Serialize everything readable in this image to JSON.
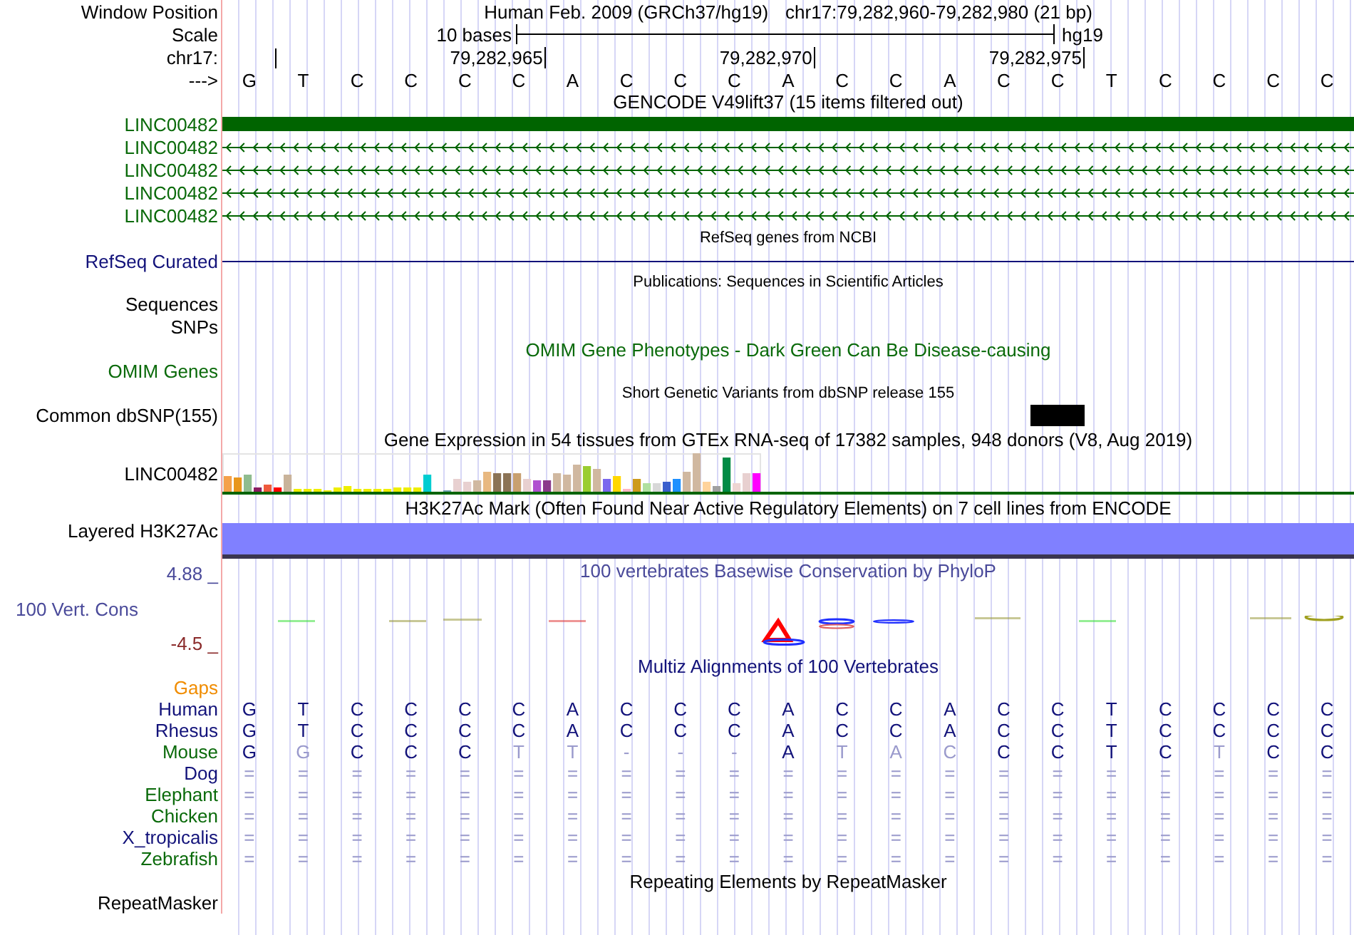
{
  "header": {
    "label": "Window Position",
    "assembly": "Human Feb. 2009 (GRCh37/hg19)",
    "position": "chr17:79,282,960-79,282,980 (21 bp)"
  },
  "scale": {
    "label": "Scale",
    "span": "10 bases",
    "assembly": "hg19"
  },
  "coordinates": {
    "label": "chr17:",
    "ticks": [
      "79,282,965",
      "79,282,970",
      "79,282,975"
    ]
  },
  "sequence": {
    "label": "--->",
    "bases": [
      "G",
      "T",
      "C",
      "C",
      "C",
      "C",
      "A",
      "C",
      "C",
      "C",
      "A",
      "C",
      "C",
      "A",
      "C",
      "C",
      "T",
      "C",
      "C",
      "C",
      "C"
    ]
  },
  "gencode": {
    "title": "GENCODE V49lift37 (15 items filtered out)",
    "genes": [
      {
        "label": "LINC00482",
        "kind": "block"
      },
      {
        "label": "LINC00482",
        "kind": "arrows"
      },
      {
        "label": "LINC00482",
        "kind": "arrows"
      },
      {
        "label": "LINC00482",
        "kind": "arrows"
      },
      {
        "label": "LINC00482",
        "kind": "arrows"
      }
    ]
  },
  "refseq": {
    "title": "RefSeq genes from NCBI",
    "label": "RefSeq Curated"
  },
  "publications": {
    "title": "Publications: Sequences in Scientific Articles",
    "labels": [
      "Sequences",
      "SNPs"
    ]
  },
  "omim": {
    "title": "OMIM Gene Phenotypes - Dark Green Can Be Disease-causing",
    "label": "OMIM Genes"
  },
  "dbsnp": {
    "title": "Short Genetic Variants from dbSNP release 155",
    "label": "Common dbSNP(155)"
  },
  "gtex": {
    "title": "Gene Expression in 54 tissues from GTEx RNA-seq of 17382 samples, 948 donors (V8, Aug 2019)",
    "label": "LINC00482"
  },
  "h3k27ac": {
    "title": "H3K27Ac Mark (Often Found Near Active Regulatory Elements) on 7 cell lines from ENCODE",
    "label": "Layered H3K27Ac"
  },
  "phylop": {
    "title": "100 vertebrates Basewise Conservation by PhyloP",
    "label": "100 Vert. Cons",
    "max": "4.88 _",
    "min": "-4.5 _"
  },
  "multiz": {
    "title": "Multiz Alignments of 100 Vertebrates",
    "gaps_label": "Gaps",
    "species": [
      {
        "name": "Human",
        "color": "#12127a",
        "bases": [
          {
            "b": "G",
            "faded": false
          },
          {
            "b": "T",
            "faded": false
          },
          {
            "b": "C",
            "faded": false
          },
          {
            "b": "C",
            "faded": false
          },
          {
            "b": "C",
            "faded": false
          },
          {
            "b": "C",
            "faded": false
          },
          {
            "b": "A",
            "faded": false
          },
          {
            "b": "C",
            "faded": false
          },
          {
            "b": "C",
            "faded": false
          },
          {
            "b": "C",
            "faded": false
          },
          {
            "b": "A",
            "faded": false
          },
          {
            "b": "C",
            "faded": false
          },
          {
            "b": "C",
            "faded": false
          },
          {
            "b": "A",
            "faded": false
          },
          {
            "b": "C",
            "faded": false
          },
          {
            "b": "C",
            "faded": false
          },
          {
            "b": "T",
            "faded": false
          },
          {
            "b": "C",
            "faded": false
          },
          {
            "b": "C",
            "faded": false
          },
          {
            "b": "C",
            "faded": false
          },
          {
            "b": "C",
            "faded": false
          }
        ]
      },
      {
        "name": "Rhesus",
        "color": "#12127a",
        "bases": [
          {
            "b": "G",
            "faded": false
          },
          {
            "b": "T",
            "faded": false
          },
          {
            "b": "C",
            "faded": false
          },
          {
            "b": "C",
            "faded": false
          },
          {
            "b": "C",
            "faded": false
          },
          {
            "b": "C",
            "faded": false
          },
          {
            "b": "A",
            "faded": false
          },
          {
            "b": "C",
            "faded": false
          },
          {
            "b": "C",
            "faded": false
          },
          {
            "b": "C",
            "faded": false
          },
          {
            "b": "A",
            "faded": false
          },
          {
            "b": "C",
            "faded": false
          },
          {
            "b": "C",
            "faded": false
          },
          {
            "b": "A",
            "faded": false
          },
          {
            "b": "C",
            "faded": false
          },
          {
            "b": "C",
            "faded": false
          },
          {
            "b": "T",
            "faded": false
          },
          {
            "b": "C",
            "faded": false
          },
          {
            "b": "C",
            "faded": false
          },
          {
            "b": "C",
            "faded": false
          },
          {
            "b": "C",
            "faded": false
          }
        ]
      },
      {
        "name": "Mouse",
        "color": "#0a6a0a",
        "bases": [
          {
            "b": "G",
            "faded": false
          },
          {
            "b": "G",
            "faded": true
          },
          {
            "b": "C",
            "faded": false
          },
          {
            "b": "C",
            "faded": false
          },
          {
            "b": "C",
            "faded": false
          },
          {
            "b": "T",
            "faded": true
          },
          {
            "b": "T",
            "faded": true
          },
          {
            "b": "-",
            "faded": true
          },
          {
            "b": "-",
            "faded": true
          },
          {
            "b": "-",
            "faded": true
          },
          {
            "b": "A",
            "faded": false
          },
          {
            "b": "T",
            "faded": true
          },
          {
            "b": "A",
            "faded": true
          },
          {
            "b": "C",
            "faded": true
          },
          {
            "b": "C",
            "faded": false
          },
          {
            "b": "C",
            "faded": false
          },
          {
            "b": "T",
            "faded": false
          },
          {
            "b": "C",
            "faded": false
          },
          {
            "b": "T",
            "faded": true
          },
          {
            "b": "C",
            "faded": false
          },
          {
            "b": "C",
            "faded": false
          }
        ]
      },
      {
        "name": "Dog",
        "color": "#12127a",
        "bases": [
          {
            "b": "=",
            "faded": true
          },
          {
            "b": "=",
            "faded": true
          },
          {
            "b": "=",
            "faded": true
          },
          {
            "b": "=",
            "faded": true
          },
          {
            "b": "=",
            "faded": true
          },
          {
            "b": "=",
            "faded": true
          },
          {
            "b": "=",
            "faded": true
          },
          {
            "b": "=",
            "faded": true
          },
          {
            "b": "=",
            "faded": true
          },
          {
            "b": "=",
            "faded": true
          },
          {
            "b": "=",
            "faded": true
          },
          {
            "b": "=",
            "faded": true
          },
          {
            "b": "=",
            "faded": true
          },
          {
            "b": "=",
            "faded": true
          },
          {
            "b": "=",
            "faded": true
          },
          {
            "b": "=",
            "faded": true
          },
          {
            "b": "=",
            "faded": true
          },
          {
            "b": "=",
            "faded": true
          },
          {
            "b": "=",
            "faded": true
          },
          {
            "b": "=",
            "faded": true
          },
          {
            "b": "=",
            "faded": true
          }
        ]
      },
      {
        "name": "Elephant",
        "color": "#0a6a0a",
        "bases": [
          {
            "b": "=",
            "faded": true
          },
          {
            "b": "=",
            "faded": true
          },
          {
            "b": "=",
            "faded": true
          },
          {
            "b": "=",
            "faded": true
          },
          {
            "b": "=",
            "faded": true
          },
          {
            "b": "=",
            "faded": true
          },
          {
            "b": "=",
            "faded": true
          },
          {
            "b": "=",
            "faded": true
          },
          {
            "b": "=",
            "faded": true
          },
          {
            "b": "=",
            "faded": true
          },
          {
            "b": "=",
            "faded": true
          },
          {
            "b": "=",
            "faded": true
          },
          {
            "b": "=",
            "faded": true
          },
          {
            "b": "=",
            "faded": true
          },
          {
            "b": "=",
            "faded": true
          },
          {
            "b": "=",
            "faded": true
          },
          {
            "b": "=",
            "faded": true
          },
          {
            "b": "=",
            "faded": true
          },
          {
            "b": "=",
            "faded": true
          },
          {
            "b": "=",
            "faded": true
          },
          {
            "b": "=",
            "faded": true
          }
        ]
      },
      {
        "name": "Chicken",
        "color": "#0a6a0a",
        "bases": [
          {
            "b": "=",
            "faded": true
          },
          {
            "b": "=",
            "faded": true
          },
          {
            "b": "=",
            "faded": true
          },
          {
            "b": "=",
            "faded": true
          },
          {
            "b": "=",
            "faded": true
          },
          {
            "b": "=",
            "faded": true
          },
          {
            "b": "=",
            "faded": true
          },
          {
            "b": "=",
            "faded": true
          },
          {
            "b": "=",
            "faded": true
          },
          {
            "b": "=",
            "faded": true
          },
          {
            "b": "=",
            "faded": true
          },
          {
            "b": "=",
            "faded": true
          },
          {
            "b": "=",
            "faded": true
          },
          {
            "b": "=",
            "faded": true
          },
          {
            "b": "=",
            "faded": true
          },
          {
            "b": "=",
            "faded": true
          },
          {
            "b": "=",
            "faded": true
          },
          {
            "b": "=",
            "faded": true
          },
          {
            "b": "=",
            "faded": true
          },
          {
            "b": "=",
            "faded": true
          },
          {
            "b": "=",
            "faded": true
          }
        ]
      },
      {
        "name": "X_tropicalis",
        "color": "#12127a",
        "bases": [
          {
            "b": "=",
            "faded": true
          },
          {
            "b": "=",
            "faded": true
          },
          {
            "b": "=",
            "faded": true
          },
          {
            "b": "=",
            "faded": true
          },
          {
            "b": "=",
            "faded": true
          },
          {
            "b": "=",
            "faded": true
          },
          {
            "b": "=",
            "faded": true
          },
          {
            "b": "=",
            "faded": true
          },
          {
            "b": "=",
            "faded": true
          },
          {
            "b": "=",
            "faded": true
          },
          {
            "b": "=",
            "faded": true
          },
          {
            "b": "=",
            "faded": true
          },
          {
            "b": "=",
            "faded": true
          },
          {
            "b": "=",
            "faded": true
          },
          {
            "b": "=",
            "faded": true
          },
          {
            "b": "=",
            "faded": true
          },
          {
            "b": "=",
            "faded": true
          },
          {
            "b": "=",
            "faded": true
          },
          {
            "b": "=",
            "faded": true
          },
          {
            "b": "=",
            "faded": true
          },
          {
            "b": "=",
            "faded": true
          }
        ]
      },
      {
        "name": "Zebrafish",
        "color": "#0a6a0a",
        "bases": [
          {
            "b": "=",
            "faded": true
          },
          {
            "b": "=",
            "faded": true
          },
          {
            "b": "=",
            "faded": true
          },
          {
            "b": "=",
            "faded": true
          },
          {
            "b": "=",
            "faded": true
          },
          {
            "b": "=",
            "faded": true
          },
          {
            "b": "=",
            "faded": true
          },
          {
            "b": "=",
            "faded": true
          },
          {
            "b": "=",
            "faded": true
          },
          {
            "b": "=",
            "faded": true
          },
          {
            "b": "=",
            "faded": true
          },
          {
            "b": "=",
            "faded": true
          },
          {
            "b": "=",
            "faded": true
          },
          {
            "b": "=",
            "faded": true
          },
          {
            "b": "=",
            "faded": true
          },
          {
            "b": "=",
            "faded": true
          },
          {
            "b": "=",
            "faded": true
          },
          {
            "b": "=",
            "faded": true
          },
          {
            "b": "=",
            "faded": true
          },
          {
            "b": "=",
            "faded": true
          },
          {
            "b": "=",
            "faded": true
          }
        ]
      }
    ]
  },
  "repeatmasker": {
    "title": "Repeating Elements by RepeatMasker",
    "label": "RepeatMasker"
  }
}
